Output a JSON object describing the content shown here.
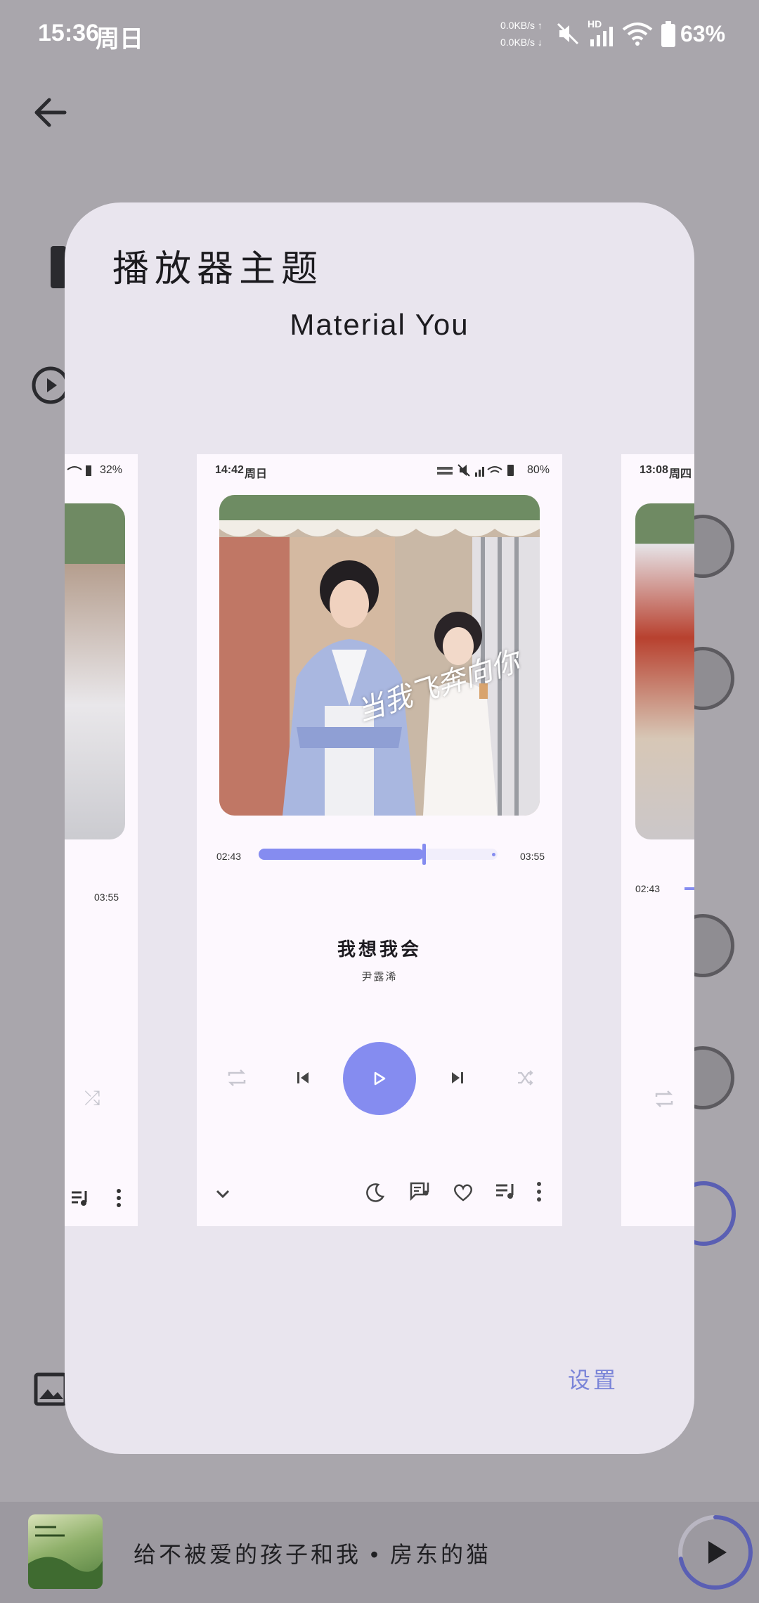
{
  "status_bar": {
    "time": "15:36",
    "day": "周日",
    "net_up": "0.0KB/s ↑",
    "net_down": "0.0KB/s ↓",
    "hd": "HD",
    "battery": "63%"
  },
  "dialog": {
    "title": "播放器主题",
    "theme_name": "Material You",
    "settings_label": "设置"
  },
  "preview_center": {
    "status_time": "14:42",
    "status_day": "周日",
    "status_battery": "80%",
    "elapsed": "02:43",
    "total": "03:55",
    "progress": 0.69,
    "song_title": "我想我会",
    "artist": "尹露浠",
    "cover_text": "当我飞奔向你"
  },
  "preview_left": {
    "status_battery": "32%",
    "total": "03:55"
  },
  "preview_right": {
    "status_time": "13:08",
    "status_day": "周四",
    "elapsed": "02:43"
  },
  "mini_player": {
    "title": "给不被爱的孩子和我 • 房东的猫",
    "progress": 0.72
  },
  "colors": {
    "accent": "#858cf0",
    "dialog_bg": "#e9e5ee",
    "scrim": "#a9a6ac"
  }
}
